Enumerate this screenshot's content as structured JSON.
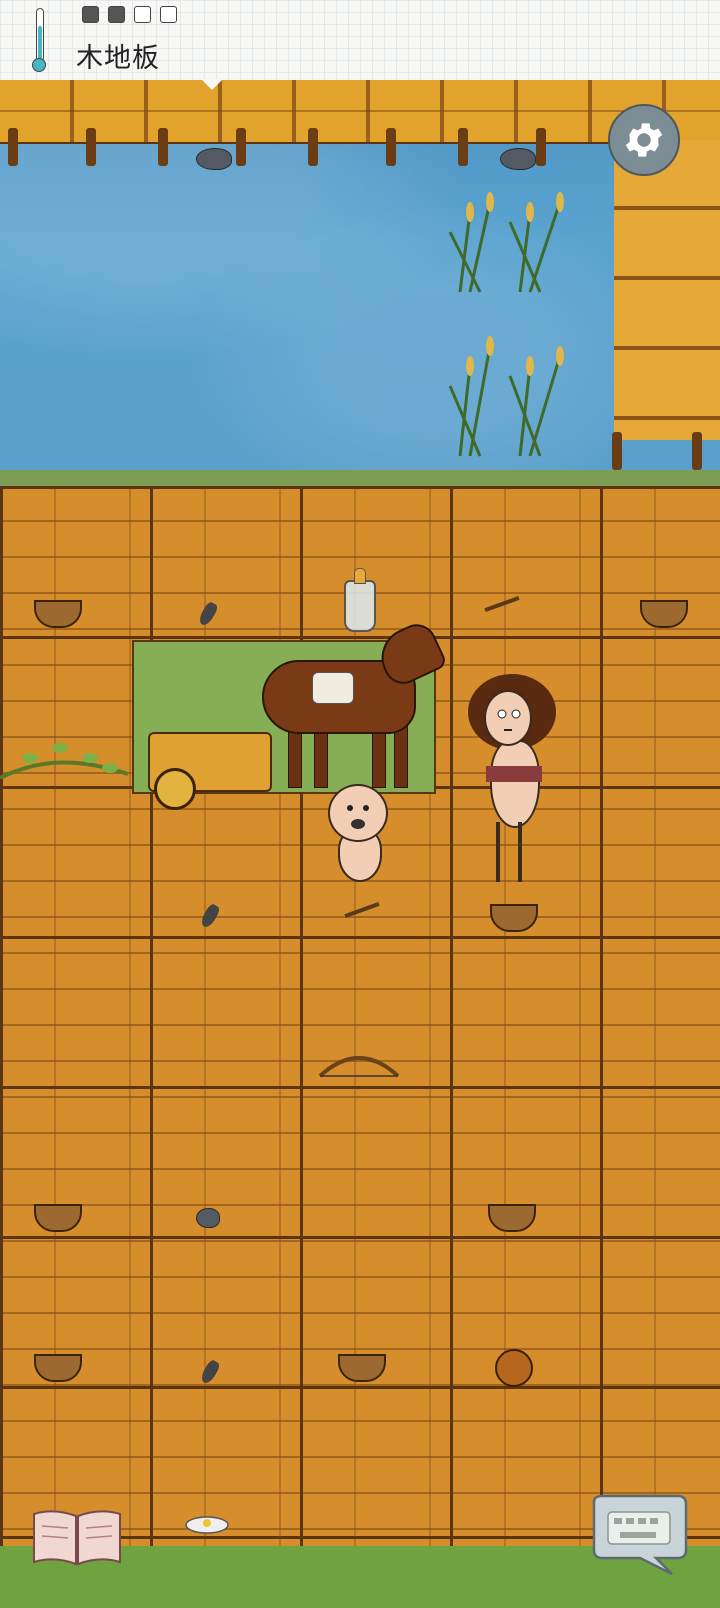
{
  "hud": {
    "tile_label": "木地板",
    "food_pips": [
      "full",
      "full",
      "empty",
      "empty"
    ],
    "temperature_color": "#46b6c4"
  },
  "controls": {
    "settings_icon": "gear-icon",
    "journal_icon": "open-book-icon",
    "chat_icon": "keyboard-chat-bubble-icon"
  },
  "scene": {
    "terrain": [
      "water",
      "wooden-bridge",
      "wooden-floor",
      "grass"
    ],
    "characters": [
      "crying-baby",
      "curly-haired-mother"
    ],
    "animals": [
      "saddled-horse-with-cart"
    ]
  }
}
